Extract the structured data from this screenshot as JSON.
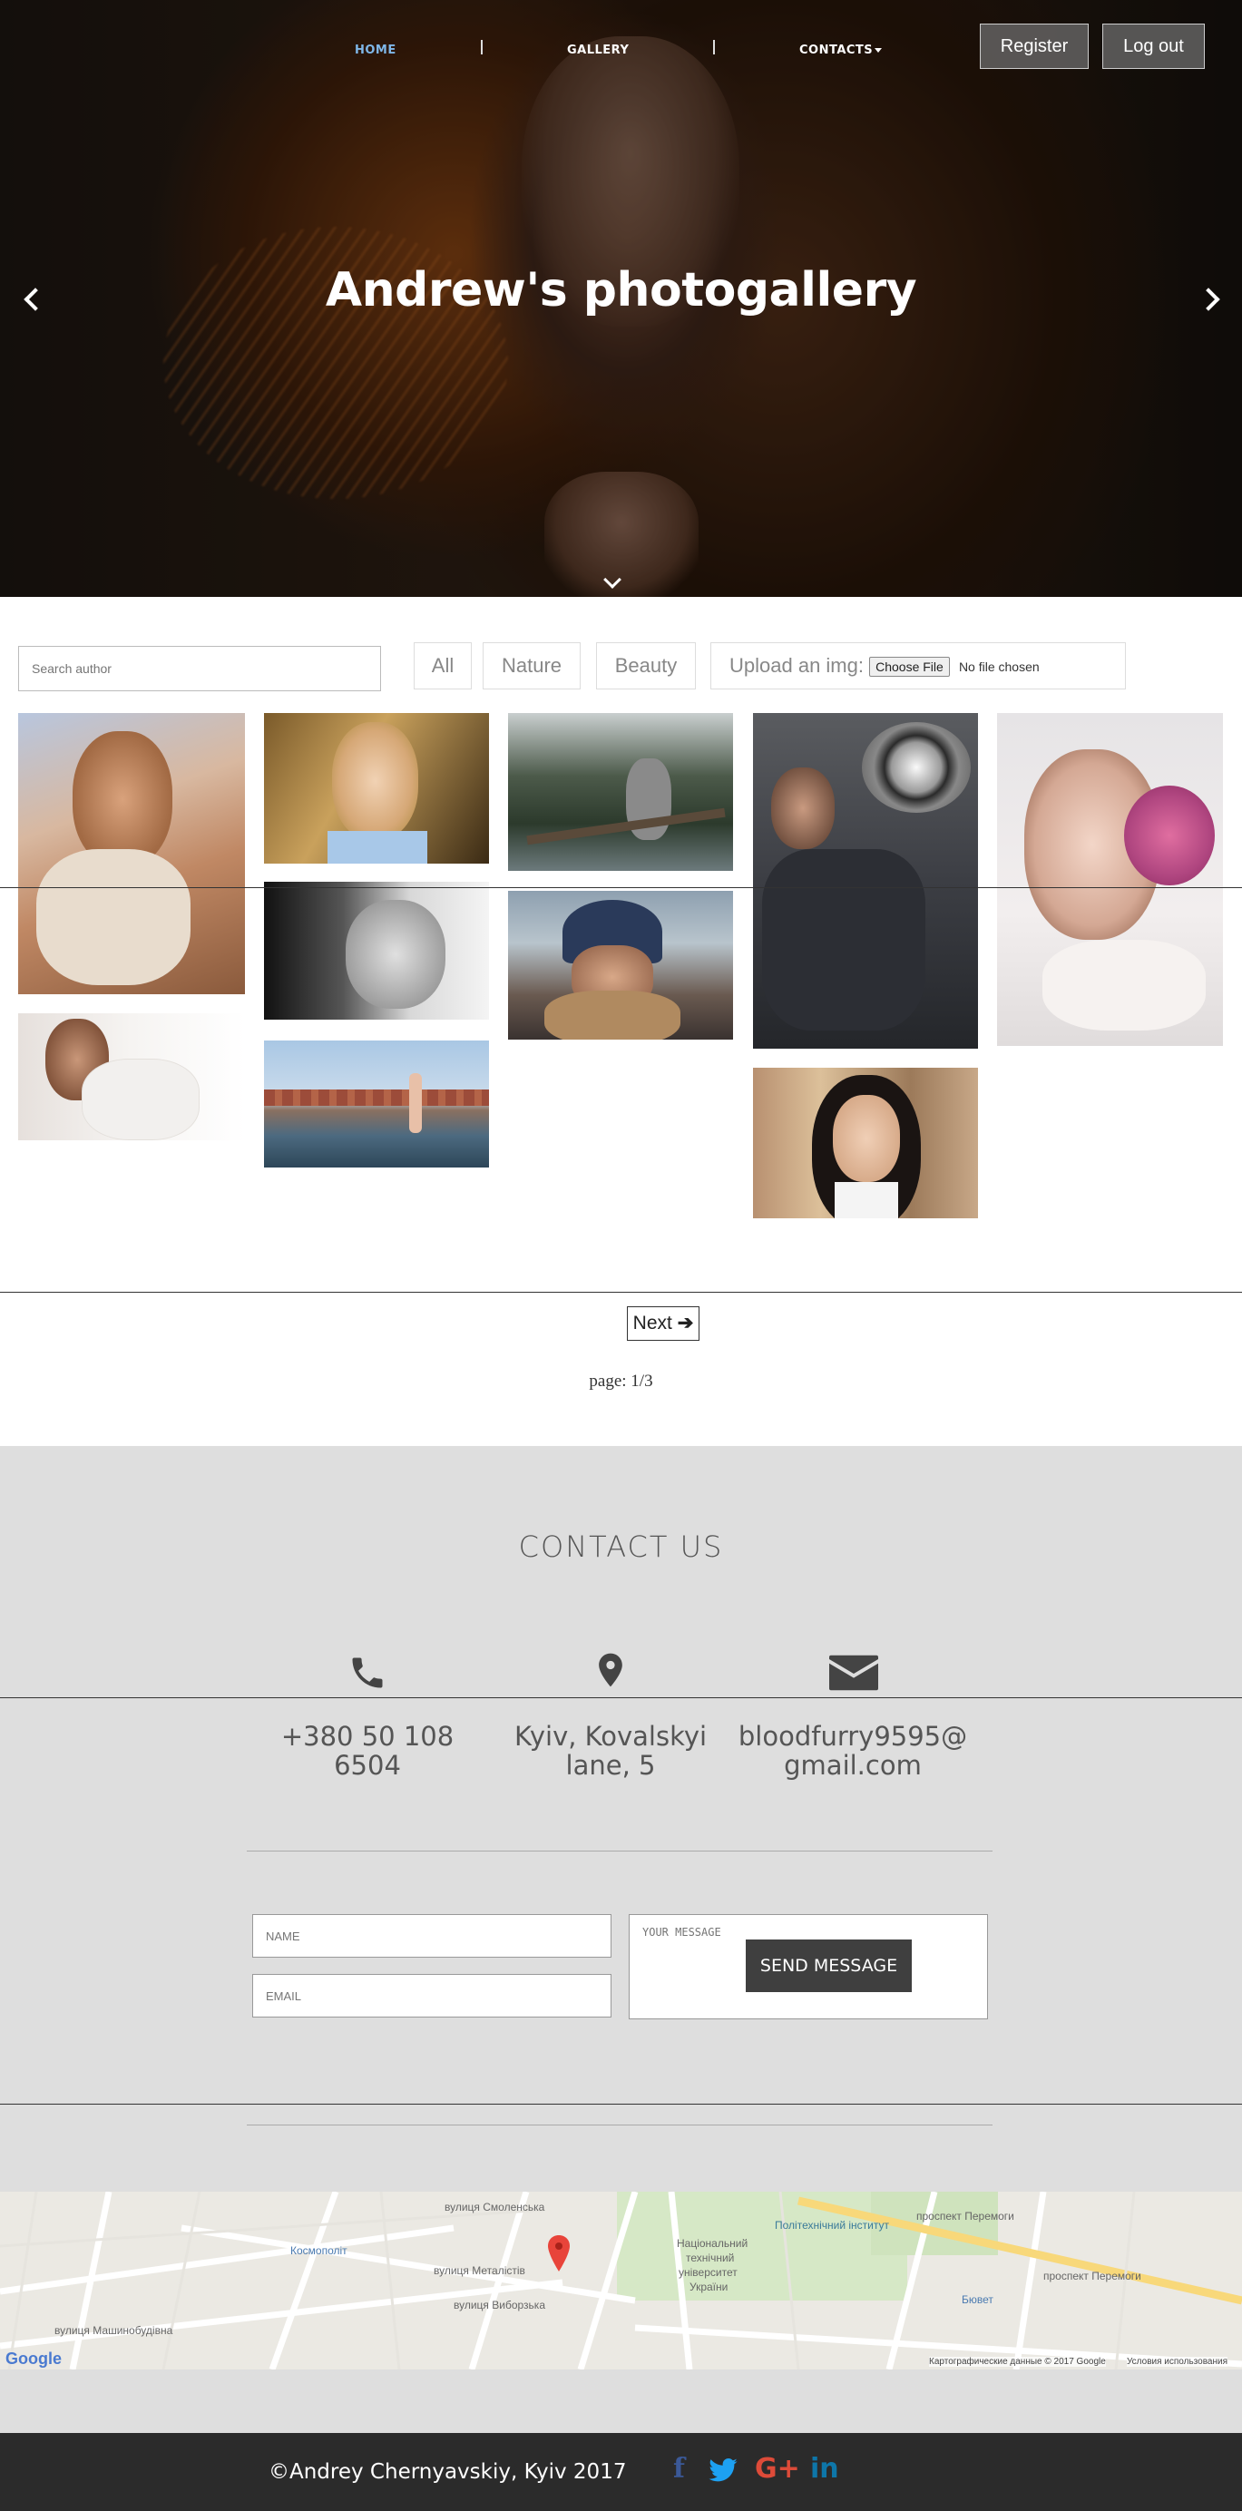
{
  "nav": {
    "home": "HOME",
    "gallery": "GALLERY",
    "contacts": "CONTACTS",
    "register": "Register",
    "logout": "Log out"
  },
  "hero": {
    "title": "Andrew's photogallery"
  },
  "toolbar": {
    "search_placeholder": "Search author",
    "filters": [
      "All",
      "Nature",
      "Beauty"
    ],
    "upload_label": "Upload an img:",
    "choose_file": "Choose File",
    "no_file": "No file chosen"
  },
  "pagination": {
    "next": "Next",
    "page": "page: 1/3"
  },
  "contact": {
    "title": "CONTACT US",
    "phone": "+380 50 108 6504",
    "address_line1": "Kyiv, Kovalskyi",
    "address_line2": "lane, 5",
    "email_line1": "bloodfurry9595@",
    "email_line2": "gmail.com",
    "name_placeholder": "NAME",
    "email_placeholder": "EMAIL",
    "message_placeholder": "YOUR MESSAGE",
    "send": "SEND MESSAGE"
  },
  "map": {
    "labels": [
      "вулиця Смоленська",
      "Космополіт",
      "вулиця Металістів",
      "вулиця Машинобудівна",
      "Національний",
      "технічний",
      "університет",
      "України",
      "Політехнічний інститут",
      "проспект Перемоги",
      "проспект Перемоги",
      "Бювет",
      "вулиця Виборзька"
    ],
    "google": "Google",
    "credits": "Картографические данные © 2017 Google",
    "terms": "Условия использования"
  },
  "footer": {
    "copyright": "©Andrey Chernyavskiy, Kyiv 2017"
  },
  "social_icons": [
    "facebook-icon",
    "twitter-icon",
    "google-plus-icon",
    "linkedin-icon"
  ],
  "colors": {
    "accent": "#7fb7e8",
    "contact_bg": "#dedede",
    "footer_bg": "#2b2b2b",
    "send_btn": "#3f3f3f"
  }
}
